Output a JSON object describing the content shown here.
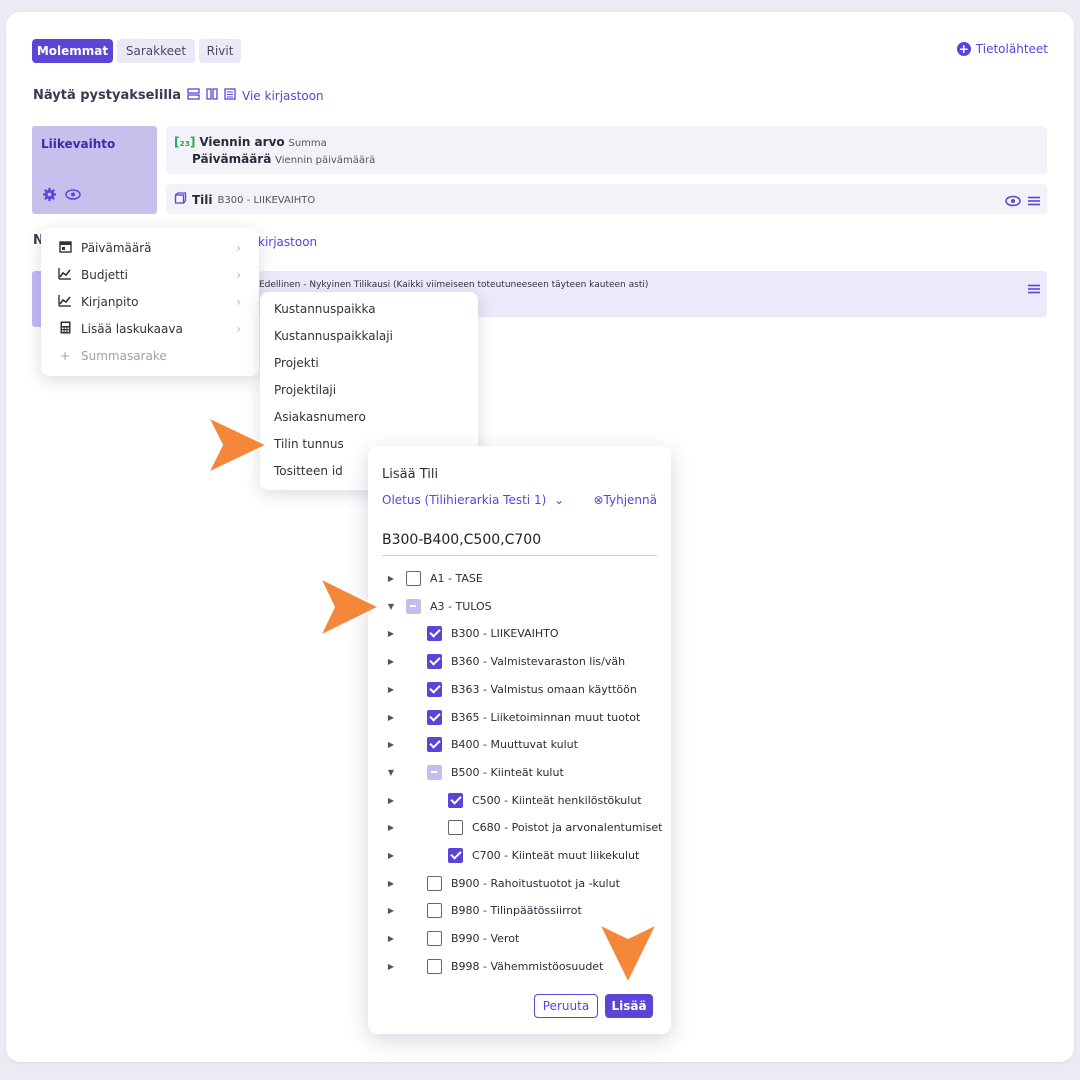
{
  "toggle": {
    "both": "Molemmat",
    "columns": "Sarakkeet",
    "rows": "Rivit"
  },
  "sources_label": "Tietolähteet",
  "vertical_axis": {
    "title": "Näytä pystyakselilla",
    "export_link": "Vie kirjastoon"
  },
  "row_card": {
    "title": "Liikevaihto"
  },
  "viennin": {
    "label": "Viennin arvo",
    "sub": "Summa",
    "date_label": "Päivämäärä",
    "date_sub": "Viennin päivämäärä"
  },
  "tili": {
    "label": "Tili",
    "value": "B300 - LIIKEVAIHTO"
  },
  "horizontal_axis": {
    "letter": "N",
    "export_link": "kirjastoon"
  },
  "period_row": {
    "text": "Edellinen - Nykyinen Tilikausi (Kaikki viimeiseen toteutuneeseen täyteen kauteen asti)"
  },
  "menu": {
    "items": [
      {
        "label": "Päivämäärä",
        "icon": "calendar-icon"
      },
      {
        "label": "Budjetti",
        "icon": "chart-icon"
      },
      {
        "label": "Kirjanpito",
        "icon": "chart-icon"
      },
      {
        "label": "Lisää laskukaava",
        "icon": "calculator-icon"
      },
      {
        "label": "Summasarake",
        "icon": "plus-icon"
      }
    ]
  },
  "submenu": {
    "items": [
      "Kustannuspaikka",
      "Kustannuspaikkalaji",
      "Projekti",
      "Projektilaji",
      "Asiakasnumero",
      "Tilin tunnus",
      "Tositteen id"
    ]
  },
  "dialog": {
    "title": "Lisää Tili",
    "hierarchy": "Oletus (Tilihierarkia Testi 1)",
    "clear": "Tyhjennä",
    "input_value": "B300-B400,C500,C700",
    "tree": [
      {
        "label": "A1 - TASE",
        "state": "empty"
      },
      {
        "label": "A3 - TULOS",
        "state": "partial"
      },
      {
        "label": "B300 - LIIKEVAIHTO",
        "state": "checked"
      },
      {
        "label": "B360 - Valmistevaraston lis/väh",
        "state": "checked"
      },
      {
        "label": "B363 - Valmistus omaan käyttöön",
        "state": "checked"
      },
      {
        "label": "B365 - Liiketoiminnan muut tuotot",
        "state": "checked"
      },
      {
        "label": "B400 - Muuttuvat kulut",
        "state": "checked"
      },
      {
        "label": "B500 - Kiinteät kulut",
        "state": "partial"
      },
      {
        "label": "C500 - Kiinteät henkilöstökulut",
        "state": "checked"
      },
      {
        "label": "C680 - Poistot ja arvonalentumiset",
        "state": "empty"
      },
      {
        "label": "C700 - Kiinteät muut liikekulut",
        "state": "checked"
      },
      {
        "label": "B900 - Rahoitustuotot ja -kulut",
        "state": "empty"
      },
      {
        "label": "B980 - Tilinpäätössiirrot",
        "state": "empty"
      },
      {
        "label": "B990 - Verot",
        "state": "empty"
      },
      {
        "label": "B998 - Vähemmistöosuudet",
        "state": "empty"
      }
    ],
    "cancel": "Peruuta",
    "add": "Lisää"
  },
  "colors": {
    "accent": "#5b45d6",
    "card": "#c5c0ec",
    "arrow": "#f5873a"
  }
}
